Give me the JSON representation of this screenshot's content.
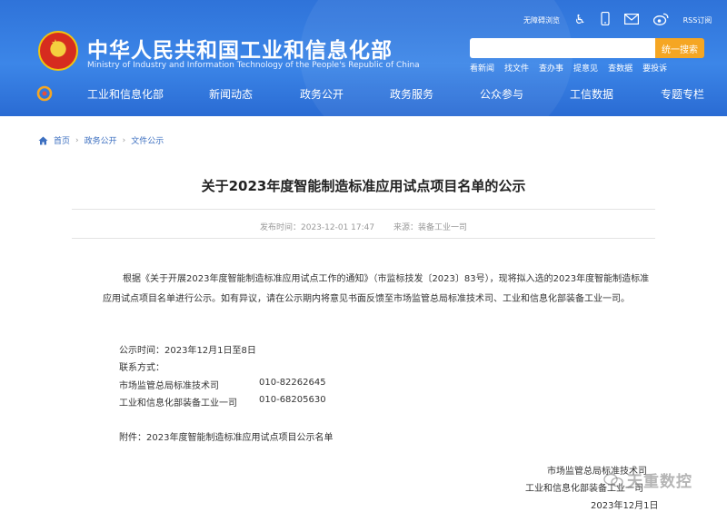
{
  "header": {
    "site_title": "中华人民共和国工业和信息化部",
    "site_subtitle": "Ministry of Industry and Information Technology of the People's Republic of China",
    "toplinks": [
      "无障碍浏览",
      "RSS订阅"
    ],
    "search": {
      "placeholder": "",
      "button": "统一搜索"
    },
    "quicklinks": [
      "看新闻",
      "找文件",
      "查办事",
      "提意见",
      "查数据",
      "要投诉"
    ]
  },
  "nav": {
    "items": [
      "工业和信息化部",
      "新闻动态",
      "政务公开",
      "政务服务",
      "公众参与",
      "工信数据",
      "专题专栏"
    ]
  },
  "breadcrumb": [
    "首页",
    "政务公开",
    "文件公示"
  ],
  "article": {
    "title": "关于2023年度智能制造标准应用试点项目名单的公示",
    "publish_time": "发布时间：2023-12-01 17:47",
    "source": "来源：装备工业一司",
    "paragraph": "根据《关于开展2023年度智能制造标准应用试点工作的通知》（市监标技发〔2023〕83号），现将拟入选的2023年度智能制造标准应用试点项目名单进行公示。如有异议，请在公示期内将意见书面反馈至市场监管总局标准技术司、工业和信息化部装备工业一司。",
    "period": "公示时间：2023年12月1日至8日",
    "contact_label": "联系方式：",
    "contacts": [
      {
        "org": "市场监管总局标准技术司",
        "phone": "010-82262645"
      },
      {
        "org": "工业和信息化部装备工业一司",
        "phone": "010-68205630"
      }
    ],
    "attachment": "附件：2023年度智能制造标准应用试点项目公示名单",
    "signature": [
      "市场监管总局标准技术司",
      "工业和信息化部装备工业一司",
      "2023年12月1日"
    ]
  },
  "watermark": {
    "text": "天重数控"
  }
}
